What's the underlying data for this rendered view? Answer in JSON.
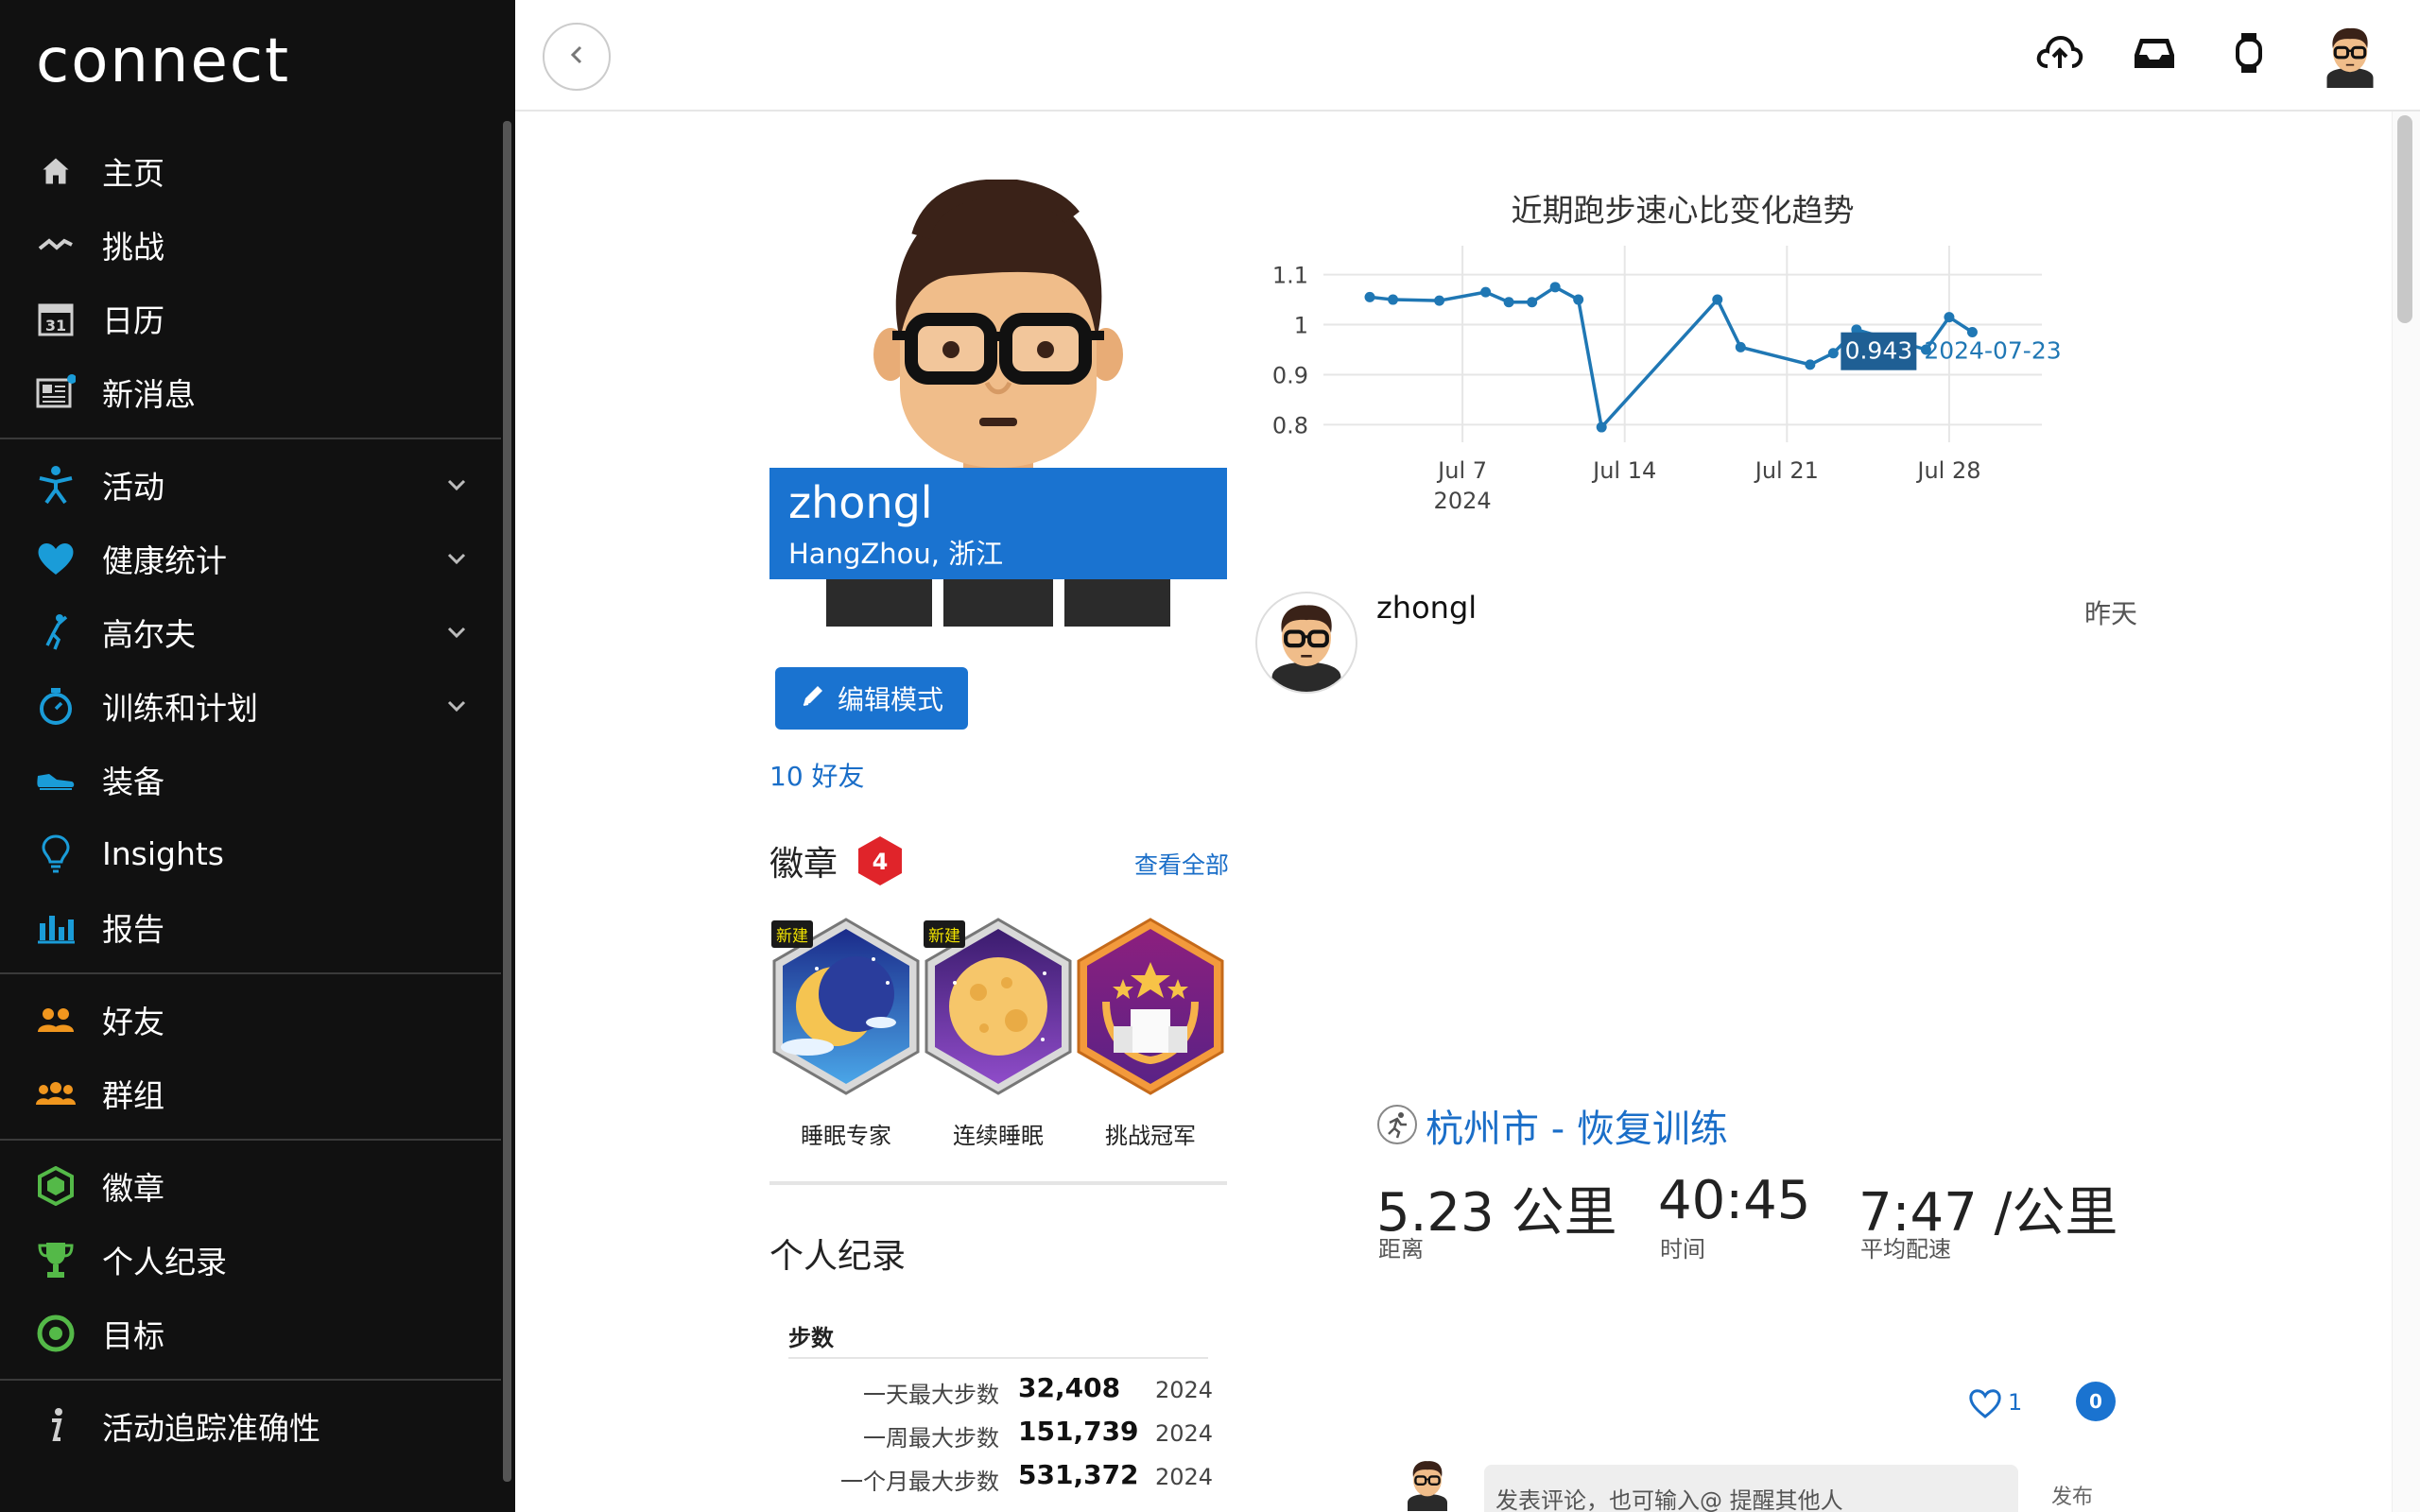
{
  "app": {
    "logo": "connect"
  },
  "sidebar": {
    "items": [
      {
        "label": "主页",
        "icon": "home-icon"
      },
      {
        "label": "挑战",
        "icon": "challenge-icon"
      },
      {
        "label": "日历",
        "icon": "calendar-icon",
        "icon_text": "31"
      },
      {
        "label": "新消息",
        "icon": "news-icon"
      },
      {
        "label": "活动",
        "icon": "activity-icon",
        "expandable": true
      },
      {
        "label": "健康统计",
        "icon": "heart-icon",
        "expandable": true
      },
      {
        "label": "高尔夫",
        "icon": "golf-icon",
        "expandable": true
      },
      {
        "label": "训练和计划",
        "icon": "stopwatch-icon",
        "expandable": true
      },
      {
        "label": "装备",
        "icon": "shoe-icon"
      },
      {
        "label": "Insights",
        "icon": "lightbulb-icon"
      },
      {
        "label": "报告",
        "icon": "report-icon"
      },
      {
        "label": "好友",
        "icon": "friends-icon"
      },
      {
        "label": "群组",
        "icon": "groups-icon"
      },
      {
        "label": "徽章",
        "icon": "badge-icon"
      },
      {
        "label": "个人纪录",
        "icon": "trophy-icon"
      },
      {
        "label": "目标",
        "icon": "target-icon"
      },
      {
        "label": "活动追踪准确性",
        "icon": "info-icon"
      }
    ],
    "colors": {
      "blue": "#1a9cd8",
      "orange": "#f0961e",
      "green": "#54b948"
    }
  },
  "topbar": {
    "icons": [
      "back-icon",
      "upload-icon",
      "inbox-icon",
      "watch-icon",
      "avatar"
    ]
  },
  "profile": {
    "name": "zhongl",
    "location": "HangZhou, 浙江",
    "edit_label": "编辑模式",
    "friends": "10  好友"
  },
  "badges": {
    "title": "徽章",
    "count": "4",
    "view_all": "查看全部",
    "new_tag": "新建",
    "items": [
      {
        "name": "睡眠专家",
        "is_new": true
      },
      {
        "name": "连续睡眠",
        "is_new": true
      },
      {
        "name": "挑战冠军",
        "is_new": false
      }
    ]
  },
  "records": {
    "title": "个人纪录",
    "steps_header": "步数",
    "rows": [
      {
        "label": "一天最大步数",
        "value": "32,408",
        "year": "2024"
      },
      {
        "label": "一周最大步数",
        "value": "151,739",
        "year": "2024"
      },
      {
        "label": "一个月最大步数",
        "value": "531,372",
        "year": "2024"
      }
    ]
  },
  "chart_data": {
    "type": "line",
    "title": "近期跑步速心比变化趋势",
    "x_tick_labels": [
      "Jul 7\n2024",
      "Jul 14",
      "Jul 21",
      "Jul 28"
    ],
    "x_ticks": [
      "2024-07-07",
      "2024-07-14",
      "2024-07-21",
      "2024-07-28"
    ],
    "y_ticks": [
      "1.1",
      "1",
      "0.9",
      "0.8"
    ],
    "ylim": [
      0.78,
      1.12
    ],
    "grid": true,
    "color": "#1f77b4",
    "series": [
      {
        "x": [
          "2024-07-03",
          "2024-07-04",
          "2024-07-06",
          "2024-07-08",
          "2024-07-09",
          "2024-07-10",
          "2024-07-11",
          "2024-07-12",
          "2024-07-13",
          "2024-07-18",
          "2024-07-19",
          "2024-07-22",
          "2024-07-23",
          "2024-07-24",
          "2024-07-27",
          "2024-07-28",
          "2024-07-29"
        ],
        "y": [
          1.055,
          1.05,
          1.048,
          1.065,
          1.045,
          1.045,
          1.075,
          1.05,
          0.795,
          1.05,
          0.955,
          0.92,
          0.943,
          0.99,
          0.95,
          1.015,
          0.985
        ]
      }
    ],
    "tooltip": {
      "value": "0.943",
      "date": "2024-07-23"
    }
  },
  "activity": {
    "user": "zhongl",
    "time": "昨天",
    "title": "杭州市 - 恢复训练",
    "stats": [
      {
        "value": "5.23 公里",
        "label": "距离"
      },
      {
        "value": "40:45",
        "label": "时间"
      },
      {
        "value": "7:47 /公里",
        "label": "平均配速"
      }
    ],
    "likes": "1",
    "comments": "0",
    "comment_placeholder": "发表评论，也可输入@ 提醒其他人",
    "post_label": "发布"
  }
}
